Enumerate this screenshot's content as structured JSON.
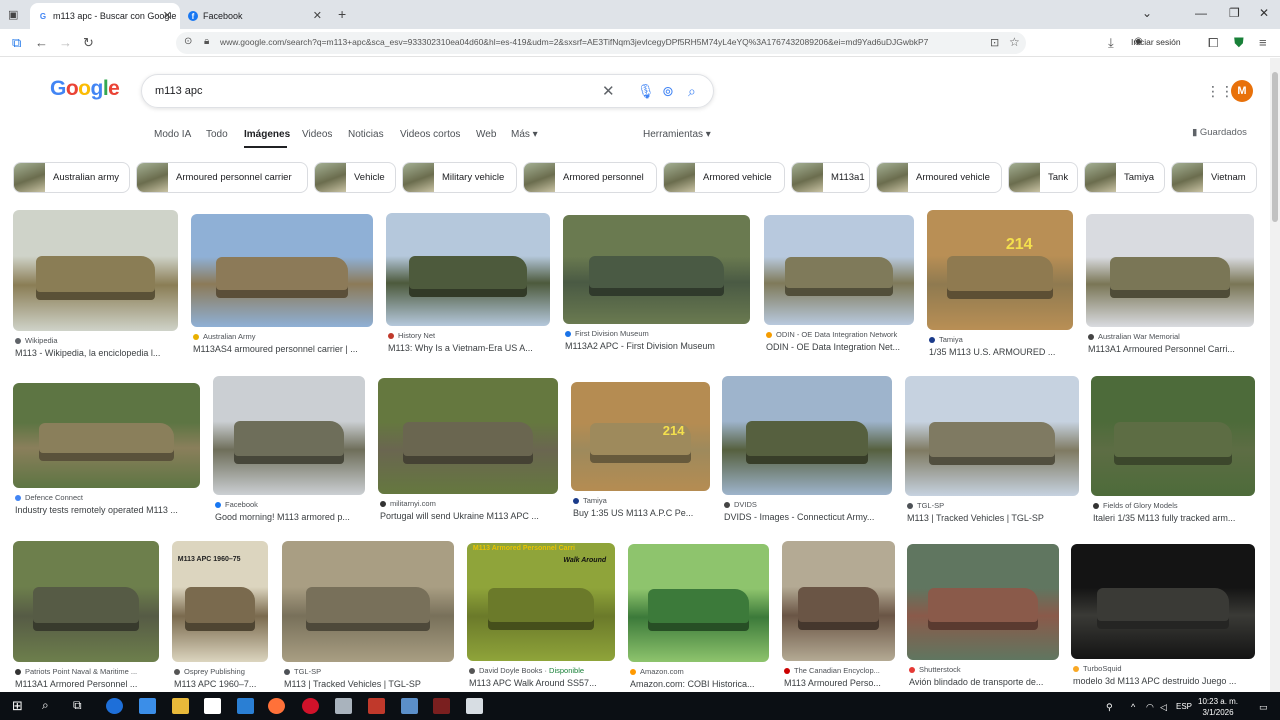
{
  "browser": {
    "tabs": [
      {
        "title": "m113 apc - Buscar con Google",
        "active": true
      },
      {
        "title": "Facebook",
        "active": false
      }
    ],
    "url": "www.google.com/search?q=m113+apc&sca_esv=933302310ea04d60&hl=es-419&udm=2&sxsrf=AE3TifNqm3jevlcegyDPf5RH5M74yL4eYQ%3A1767432089206&ei=md9Yad6uDJGwbkP7",
    "signin_label": "Iniciar sesión"
  },
  "google": {
    "query": "m113 apc",
    "logo": [
      "G",
      "o",
      "o",
      "g",
      "l",
      "e"
    ],
    "avatar_letter": "M",
    "nav_tabs": [
      "Modo IA",
      "Todo",
      "Imágenes",
      "Videos",
      "Noticias",
      "Videos cortos",
      "Web",
      "Más ▾"
    ],
    "tools_label": "Herramientas ▾",
    "saved_label": "Guardados"
  },
  "chips": [
    "Australian army",
    "Armoured personnel carrier",
    "Vehicle",
    "Military vehicle",
    "Armored personnel",
    "Armored vehicle",
    "M113a1",
    "Armoured vehicle",
    "Tank",
    "Tamiya",
    "Vietnam"
  ],
  "results": [
    {
      "source": "Wikipedia",
      "title": "M113 - Wikipedia, la enciclopedia l..."
    },
    {
      "source": "Australian Army",
      "title": "M113AS4 armoured personnel carrier | ..."
    },
    {
      "source": "History Net",
      "title": "M113: Why Is a Vietnam-Era US A..."
    },
    {
      "source": "First Division Museum",
      "title": "M113A2 APC - First Division Museum"
    },
    {
      "source": "ODIN - OE Data Integration Network",
      "title": "ODIN - OE Data Integration Net..."
    },
    {
      "source": "Tamiya",
      "title": "1/35 M113 U.S. ARMOURED ..."
    },
    {
      "source": "Australian War Memorial",
      "title": "M113A1 Armoured Personnel Carri..."
    },
    {
      "source": "Defence Connect",
      "title": "Industry tests remotely operated M113 ..."
    },
    {
      "source": "Facebook",
      "title": "Good morning! M113 armored p..."
    },
    {
      "source": "militarnyi.com",
      "title": "Portugal will send Ukraine M113 APC ..."
    },
    {
      "source": "Tamiya",
      "title": "Buy 1:35 US M113 A.P.C Pe..."
    },
    {
      "source": "DVIDS",
      "title": "DVIDS - Images - Connecticut Army..."
    },
    {
      "source": "TGL-SP",
      "title": "M113 | Tracked Vehicles | TGL-SP"
    },
    {
      "source": "Fields of Glory Models",
      "title": "Italeri 1/35 M113 fully tracked arm..."
    },
    {
      "source": "Patriots Point Naval & Maritime ...",
      "title": "M113A1 Armored Personnel ..."
    },
    {
      "source": "Osprey Publishing",
      "title": "M113 APC 1960–7..."
    },
    {
      "source": "TGL-SP",
      "title": "M113 | Tracked Vehicles | TGL-SP"
    },
    {
      "source": "David Doyle Books · ",
      "badge": "Disponible",
      "title": "M113 APC Walk Around SS57..."
    },
    {
      "source": "Amazon.com",
      "title": "Amazon.com: COBI Historica..."
    },
    {
      "source": "The Canadian Encyclop...",
      "title": "M113 Armoured Perso..."
    },
    {
      "source": "Shutterstock",
      "title": "Avión blindado de transporte de..."
    },
    {
      "source": "TurboSquid",
      "title": "modelo 3d M113 APC destruido Juego ..."
    }
  ],
  "image_text": {
    "tamiya_number": "214",
    "tamiya_number_2": "214",
    "osprey_title": "M113 APC 1960–75",
    "doyle_title": "M113 Armored Personnel Carri",
    "doyle_sub": "Walk Around"
  },
  "system": {
    "time": "10:23 a. m.",
    "date": "3/1/2026",
    "lang": "ESP"
  }
}
